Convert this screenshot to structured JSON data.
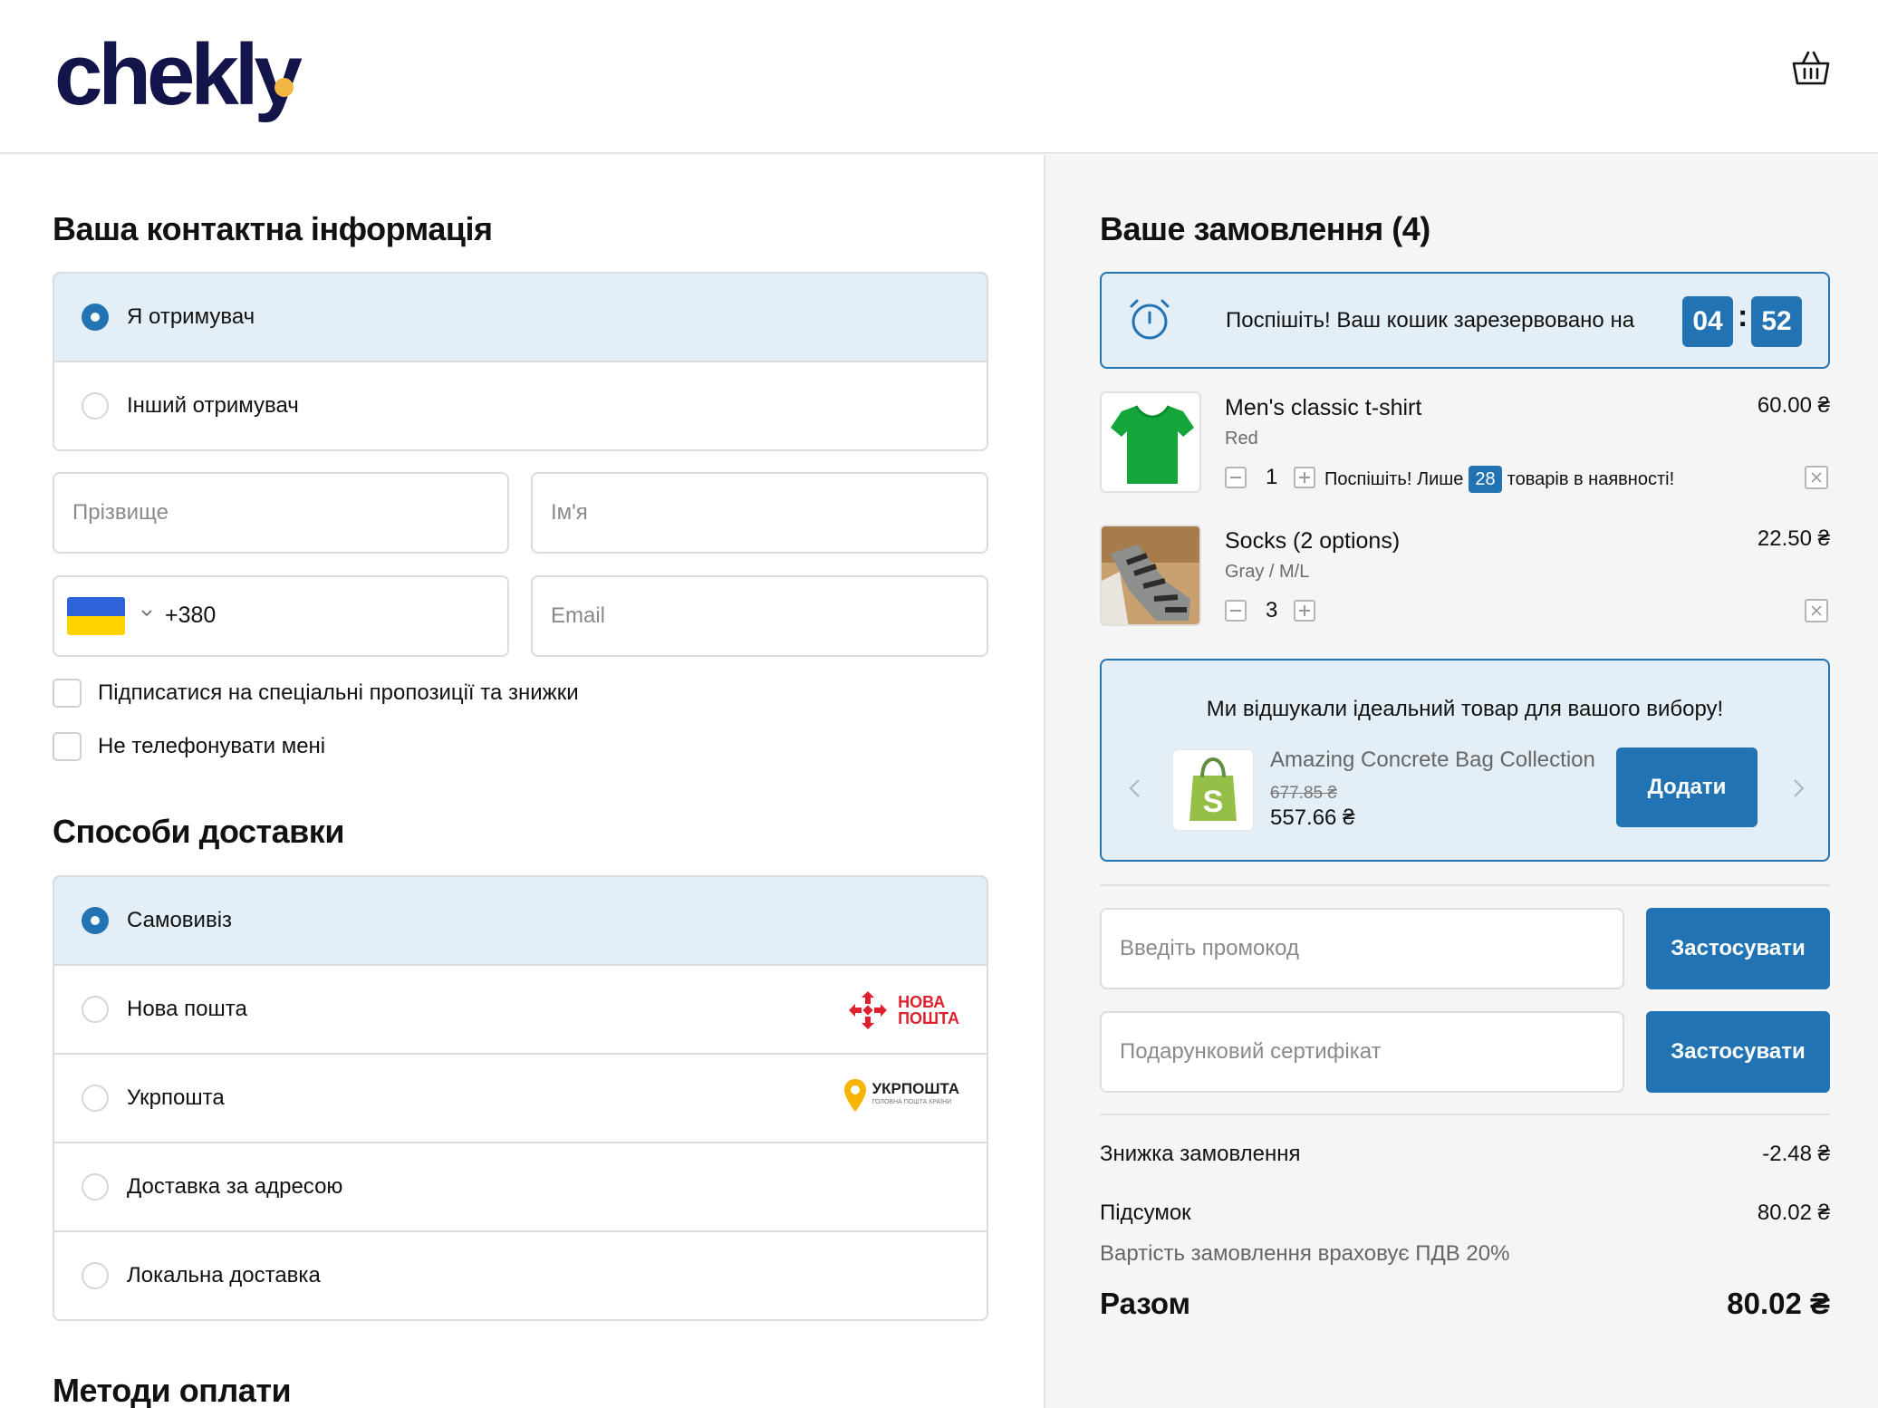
{
  "header": {
    "logo_text": "chekly",
    "brand_color": "#13144a",
    "dot_color": "#f2b541",
    "cart_icon": "basket-icon"
  },
  "contact": {
    "title": "Ваша контактна інформація",
    "recipient_options": [
      {
        "label": "Я отримувач",
        "selected": true
      },
      {
        "label": "Інший отримувач",
        "selected": false
      }
    ],
    "last_name_placeholder": "Прізвище",
    "first_name_placeholder": "Ім'я",
    "phone_code": "+380",
    "email_placeholder": "Email",
    "subscribe_label": "Підписатися на спеціальні пропозиції та знижки",
    "no_call_label": "Не телефонувати мені"
  },
  "delivery": {
    "title": "Способи доставки",
    "options": [
      {
        "label": "Самовивіз",
        "selected": true
      },
      {
        "label": "Нова пошта",
        "selected": false,
        "logo_line1": "НОВА",
        "logo_line2": "ПОШТА"
      },
      {
        "label": "Укрпошта",
        "selected": false,
        "logo_text": "УКРПОШТА",
        "logo_sub": "ГОЛОВНА ПОШТА КРАЇНИ"
      },
      {
        "label": "Доставка за адресою",
        "selected": false
      },
      {
        "label": "Локальна доставка",
        "selected": false
      }
    ]
  },
  "payment": {
    "title": "Методи оплати"
  },
  "order": {
    "title": "Ваше замовлення (4)",
    "timer": {
      "text": "Поспішіть! Ваш кошик зарезервовано на",
      "minutes": "04",
      "seconds": "52"
    },
    "items": [
      {
        "name": "Men's classic t-shirt",
        "variant": "Red",
        "price": "60.00 ₴",
        "qty": "1"
      },
      {
        "name": "Socks (2 options)",
        "variant": "Gray / M/L",
        "price": "22.50 ₴",
        "qty": "3"
      }
    ],
    "stock": {
      "before": "Поспішіть! Лише",
      "count": "28",
      "after": "товарів в наявності!"
    },
    "upsell": {
      "title": "Ми відшукали ідеальний товар для вашого вибору!",
      "name": "Amazing Concrete Bag Collection",
      "old_price": "677.85 ₴",
      "new_price": "557.66 ₴",
      "add_label": "Додати"
    },
    "promo_placeholder": "Введіть промокод",
    "gift_placeholder": "Подарунковий сертифікат",
    "apply_label": "Застосувати",
    "discount_label": "Знижка замовлення",
    "discount_value": "-2.48 ₴",
    "subtotal_label": "Підсумок",
    "subtotal_value": "80.02 ₴",
    "vat_note": "Вартість замовлення враховує ПДВ 20%",
    "total_label": "Разом",
    "total_value": "80.02 ₴"
  },
  "colors": {
    "accent": "#2273b4",
    "selected_bg": "#e3eef6",
    "nova_red": "#e0202d",
    "ukr_yellow": "#f7b500"
  }
}
